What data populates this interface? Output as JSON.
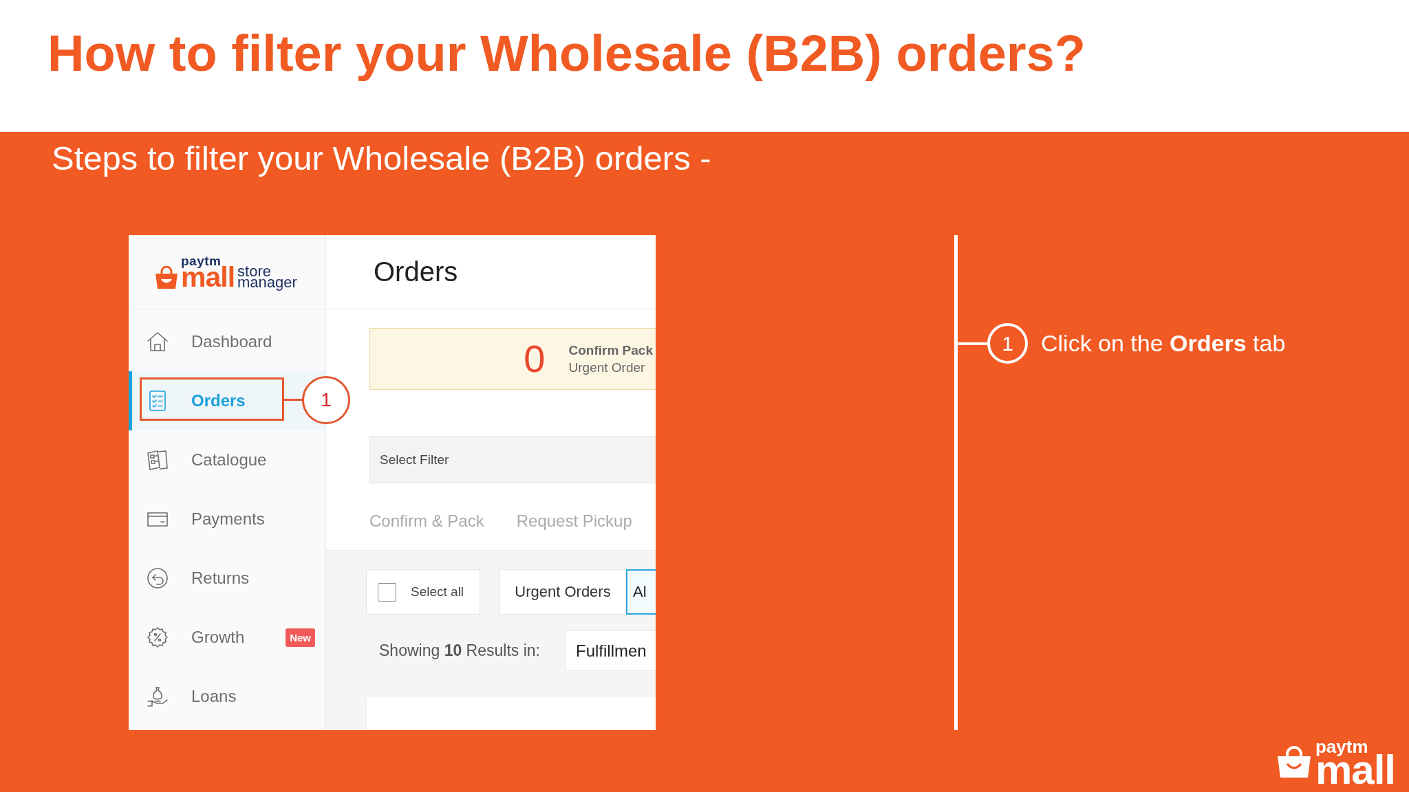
{
  "slide": {
    "title": "How to filter your Wholesale (B2B) orders?",
    "subtitle": "Steps to filter your Wholesale (B2B) orders -"
  },
  "screenshot": {
    "logo": {
      "brand": "paytm",
      "name": "mall",
      "product": [
        "store",
        "manager"
      ]
    },
    "sidebar": {
      "items": [
        {
          "label": "Dashboard",
          "selected": false
        },
        {
          "label": "Orders",
          "selected": true,
          "callout": "1"
        },
        {
          "label": "Catalogue",
          "selected": false
        },
        {
          "label": "Payments",
          "selected": false
        },
        {
          "label": "Returns",
          "selected": false
        },
        {
          "label": "Growth",
          "selected": false,
          "badge": "New"
        },
        {
          "label": "Loans",
          "selected": false
        }
      ]
    },
    "header": {
      "title": "Orders"
    },
    "urgent_card": {
      "count": "0",
      "lines": [
        "Confirm Pack",
        "Urgent Order"
      ]
    },
    "filter_field": {
      "placeholder": "Select Filter"
    },
    "tabs": [
      {
        "label": "Confirm & Pack",
        "selected": false
      },
      {
        "label": "Request Pickup",
        "selected": false
      }
    ],
    "toolbar": {
      "select_all": {
        "label": "Select all",
        "checked": false
      },
      "filter_buttons": [
        {
          "label": "Urgent Orders",
          "selected": false
        },
        {
          "label": "Al",
          "selected": true
        }
      ]
    },
    "results": {
      "text": "Showing **10** Results in:",
      "dropdown": "Fulfillmen"
    }
  },
  "steps": [
    {
      "number": "1",
      "text": "Click on the **Orders** tab"
    }
  ],
  "footer_logo": {
    "brand": "paytm",
    "name": "mall"
  }
}
